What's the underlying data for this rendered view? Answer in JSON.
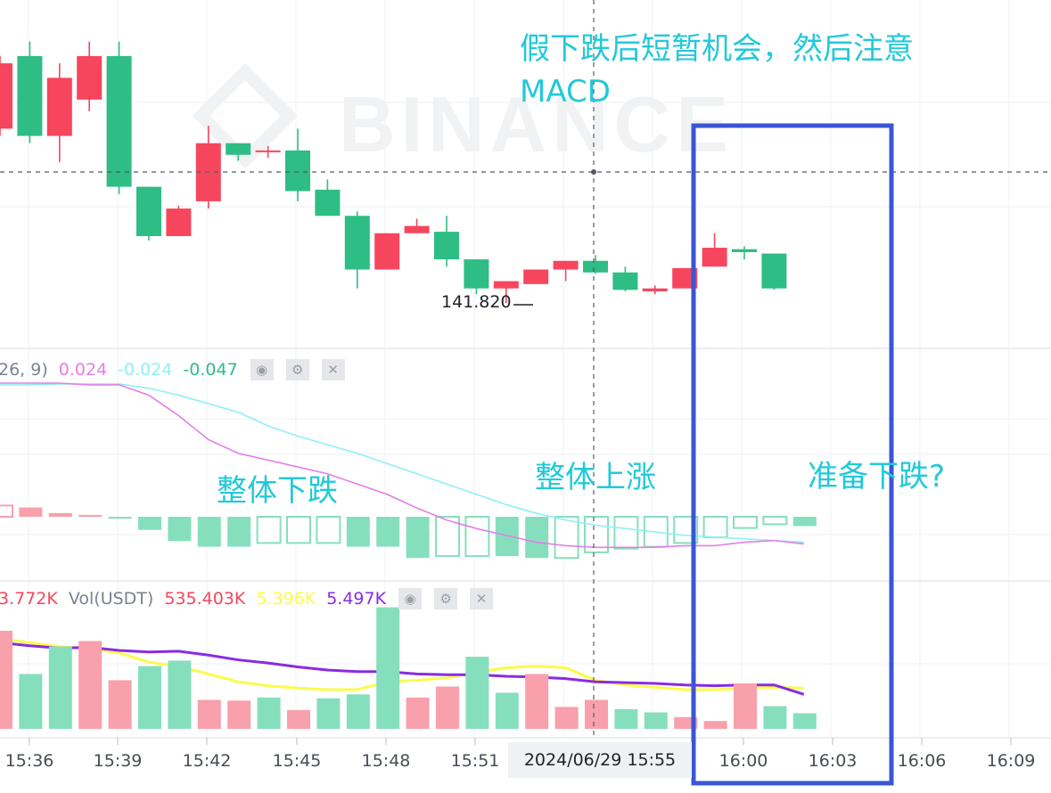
{
  "colors": {
    "up": "#f6465d",
    "down": "#2ebd85",
    "annotation": "#22c9d8",
    "highlight_box": "#3a56d4",
    "dif_line": "#e57de8",
    "dea_line": "#8ef0f7",
    "ma_yellow": "#fbfb4a",
    "ma_purple": "#8a2be2",
    "crosshair": "#555a66",
    "grid": "#eef0f3"
  },
  "watermark": "BINANCE",
  "price_label": "141.820",
  "crosshair_time": "2024/06/29 15:55",
  "macd_legend": {
    "params": "26, 9)",
    "dif": "0.024",
    "dea": "-0.024",
    "hist": "-0.047",
    "icons": [
      "eye-icon",
      "gear-icon",
      "close-icon"
    ]
  },
  "volume_legend": {
    "first": "3.772K",
    "name": "Vol(USDT)",
    "vol": "535.403K",
    "ma_yellow": "5.396K",
    "ma_purple": "5.497K",
    "icons": [
      "eye-icon",
      "gear-icon",
      "close-icon"
    ]
  },
  "annotations": {
    "top_line1": "假下跌后短暂机会，然后注意",
    "top_line2": "MACD",
    "overall_down": "整体下跌",
    "overall_up": "整体上涨",
    "prepare_down": "准备下跌?"
  },
  "chart_data": [
    {
      "type": "candlestick",
      "title": "",
      "x_tick_labels": [
        "15:36",
        "15:39",
        "15:42",
        "15:45",
        "15:48",
        "15:51",
        "16:00",
        "16:03",
        "16:06",
        "16:09"
      ],
      "annotated_low": 141.82,
      "candles": [
        {
          "time": "15:35",
          "open": 141.94,
          "close": 141.985,
          "high": 141.99,
          "low": 141.935,
          "dir": "up"
        },
        {
          "time": "15:36",
          "open": 141.99,
          "close": 141.935,
          "high": 142.0,
          "low": 141.93,
          "dir": "down"
        },
        {
          "time": "15:37",
          "open": 141.935,
          "close": 141.975,
          "high": 141.985,
          "low": 141.917,
          "dir": "up"
        },
        {
          "time": "15:38",
          "open": 141.96,
          "close": 141.99,
          "high": 142.0,
          "low": 141.952,
          "dir": "up"
        },
        {
          "time": "15:39",
          "open": 141.99,
          "close": 141.9,
          "high": 142.0,
          "low": 141.895,
          "dir": "down"
        },
        {
          "time": "15:40",
          "open": 141.9,
          "close": 141.866,
          "high": 141.9,
          "low": 141.863,
          "dir": "down"
        },
        {
          "time": "15:41",
          "open": 141.866,
          "close": 141.885,
          "high": 141.887,
          "low": 141.868,
          "dir": "up"
        },
        {
          "time": "15:42",
          "open": 141.89,
          "close": 141.93,
          "high": 141.942,
          "low": 141.885,
          "dir": "up"
        },
        {
          "time": "15:43",
          "open": 141.93,
          "close": 141.922,
          "high": 141.93,
          "low": 141.918,
          "dir": "down"
        },
        {
          "time": "15:44",
          "open": 141.925,
          "close": 141.925,
          "high": 141.928,
          "low": 141.92,
          "dir": "up"
        },
        {
          "time": "15:45",
          "open": 141.925,
          "close": 141.897,
          "high": 141.94,
          "low": 141.89,
          "dir": "down"
        },
        {
          "time": "15:46",
          "open": 141.898,
          "close": 141.88,
          "high": 141.905,
          "low": 141.88,
          "dir": "down"
        },
        {
          "time": "15:47",
          "open": 141.88,
          "close": 141.843,
          "high": 141.883,
          "low": 141.83,
          "dir": "down"
        },
        {
          "time": "15:48",
          "open": 141.843,
          "close": 141.868,
          "high": 141.868,
          "low": 141.843,
          "dir": "up"
        },
        {
          "time": "15:49",
          "open": 141.868,
          "close": 141.873,
          "high": 141.878,
          "low": 141.868,
          "dir": "up"
        },
        {
          "time": "15:50",
          "open": 141.869,
          "close": 141.85,
          "high": 141.88,
          "low": 141.845,
          "dir": "down"
        },
        {
          "time": "15:51",
          "open": 141.85,
          "close": 141.83,
          "high": 141.85,
          "low": 141.826,
          "dir": "down"
        },
        {
          "time": "15:52",
          "open": 141.83,
          "close": 141.835,
          "high": 141.835,
          "low": 141.82,
          "dir": "up"
        },
        {
          "time": "15:53",
          "open": 141.833,
          "close": 141.843,
          "high": 141.843,
          "low": 141.833,
          "dir": "up"
        },
        {
          "time": "15:54",
          "open": 141.843,
          "close": 141.849,
          "high": 141.849,
          "low": 141.835,
          "dir": "up"
        },
        {
          "time": "15:55",
          "open": 141.849,
          "close": 141.841,
          "high": 141.853,
          "low": 141.84,
          "dir": "down"
        },
        {
          "time": "15:56",
          "open": 141.841,
          "close": 141.829,
          "high": 141.845,
          "low": 141.828,
          "dir": "down"
        },
        {
          "time": "15:57",
          "open": 141.828,
          "close": 141.83,
          "high": 141.832,
          "low": 141.826,
          "dir": "up"
        },
        {
          "time": "15:58",
          "open": 141.83,
          "close": 141.844,
          "high": 141.844,
          "low": 141.83,
          "dir": "up"
        },
        {
          "time": "15:59",
          "open": 141.845,
          "close": 141.858,
          "high": 141.868,
          "low": 141.845,
          "dir": "up"
        },
        {
          "time": "16:00",
          "open": 141.857,
          "close": 141.855,
          "high": 141.859,
          "low": 141.85,
          "dir": "down"
        },
        {
          "time": "16:01",
          "open": 141.854,
          "close": 141.83,
          "high": 141.854,
          "low": 141.829,
          "dir": "down"
        }
      ]
    },
    {
      "type": "bar",
      "title": "MACD",
      "histogram": [
        {
          "value": 0.006,
          "dir": "up",
          "hollow": true
        },
        {
          "value": 0.005,
          "dir": "up",
          "hollow": false
        },
        {
          "value": 0.002,
          "dir": "up",
          "hollow": false
        },
        {
          "value": 0.001,
          "dir": "up",
          "hollow": false
        },
        {
          "value": -0.001,
          "dir": "down",
          "hollow": false
        },
        {
          "value": -0.007,
          "dir": "down",
          "hollow": false
        },
        {
          "value": -0.013,
          "dir": "down",
          "hollow": false
        },
        {
          "value": -0.016,
          "dir": "down",
          "hollow": false
        },
        {
          "value": -0.016,
          "dir": "down",
          "hollow": false
        },
        {
          "value": -0.014,
          "dir": "down",
          "hollow": true
        },
        {
          "value": -0.014,
          "dir": "down",
          "hollow": true
        },
        {
          "value": -0.014,
          "dir": "down",
          "hollow": true
        },
        {
          "value": -0.016,
          "dir": "down",
          "hollow": false
        },
        {
          "value": -0.016,
          "dir": "down",
          "hollow": false
        },
        {
          "value": -0.022,
          "dir": "down",
          "hollow": false
        },
        {
          "value": -0.021,
          "dir": "down",
          "hollow": true
        },
        {
          "value": -0.021,
          "dir": "down",
          "hollow": true
        },
        {
          "value": -0.021,
          "dir": "down",
          "hollow": false
        },
        {
          "value": -0.022,
          "dir": "down",
          "hollow": false
        },
        {
          "value": -0.022,
          "dir": "down",
          "hollow": true
        },
        {
          "value": -0.019,
          "dir": "down",
          "hollow": true
        },
        {
          "value": -0.017,
          "dir": "down",
          "hollow": true
        },
        {
          "value": -0.016,
          "dir": "down",
          "hollow": true
        },
        {
          "value": -0.014,
          "dir": "down",
          "hollow": true
        },
        {
          "value": -0.011,
          "dir": "down",
          "hollow": true
        },
        {
          "value": -0.006,
          "dir": "down",
          "hollow": true
        },
        {
          "value": -0.004,
          "dir": "down",
          "hollow": true
        },
        {
          "value": -0.005,
          "dir": "down",
          "hollow": false
        }
      ],
      "dif": [
        -0.006,
        -0.006,
        -0.0055,
        -0.0055,
        -0.0055,
        -0.008,
        -0.012,
        -0.017,
        -0.022,
        -0.03,
        -0.036,
        -0.041,
        -0.046,
        -0.052,
        -0.058,
        -0.064,
        -0.07,
        -0.076,
        -0.081,
        -0.085,
        -0.088,
        -0.09,
        -0.092,
        -0.094,
        -0.095,
        -0.096,
        -0.097,
        -0.098
      ],
      "dea": [
        -0.005,
        -0.005,
        -0.005,
        -0.006,
        -0.006,
        -0.012,
        -0.024,
        -0.038,
        -0.046,
        -0.05,
        -0.054,
        -0.058,
        -0.064,
        -0.07,
        -0.078,
        -0.085,
        -0.09,
        -0.094,
        -0.098,
        -0.1,
        -0.101,
        -0.101,
        -0.101,
        -0.1,
        -0.1,
        -0.098,
        -0.097,
        -0.099
      ]
    },
    {
      "type": "bar",
      "title": "Vol(USDT)",
      "volumes": [
        {
          "value": 12.5,
          "dir": "up"
        },
        {
          "value": 7.0,
          "dir": "down"
        },
        {
          "value": 10.5,
          "dir": "down"
        },
        {
          "value": 11.2,
          "dir": "up"
        },
        {
          "value": 6.2,
          "dir": "up"
        },
        {
          "value": 8.0,
          "dir": "down"
        },
        {
          "value": 8.7,
          "dir": "down"
        },
        {
          "value": 3.7,
          "dir": "up"
        },
        {
          "value": 3.6,
          "dir": "up"
        },
        {
          "value": 4.0,
          "dir": "down"
        },
        {
          "value": 2.4,
          "dir": "up"
        },
        {
          "value": 3.9,
          "dir": "down"
        },
        {
          "value": 4.4,
          "dir": "down"
        },
        {
          "value": 15.5,
          "dir": "down"
        },
        {
          "value": 4.0,
          "dir": "up"
        },
        {
          "value": 5.4,
          "dir": "up"
        },
        {
          "value": 9.2,
          "dir": "down"
        },
        {
          "value": 4.6,
          "dir": "down"
        },
        {
          "value": 7.0,
          "dir": "up"
        },
        {
          "value": 2.8,
          "dir": "up"
        },
        {
          "value": 3.7,
          "dir": "up"
        },
        {
          "value": 2.5,
          "dir": "down"
        },
        {
          "value": 2.1,
          "dir": "down"
        },
        {
          "value": 1.5,
          "dir": "up"
        },
        {
          "value": 1.0,
          "dir": "up"
        },
        {
          "value": 5.8,
          "dir": "up"
        },
        {
          "value": 2.9,
          "dir": "down"
        },
        {
          "value": 2.0,
          "dir": "down"
        }
      ],
      "ma_yellow": [
        11.5,
        11.0,
        10.5,
        10.2,
        9.7,
        8.5,
        8.0,
        7.0,
        6.0,
        5.5,
        5.2,
        5.0,
        5.0,
        6.0,
        6.2,
        6.5,
        7.2,
        7.8,
        8.0,
        7.8,
        6.2,
        5.6,
        5.3,
        5.0,
        5.0,
        5.2,
        5.3,
        5.2
      ],
      "ma_purple": [
        11.0,
        10.6,
        10.3,
        10.4,
        10.0,
        9.8,
        9.9,
        9.4,
        8.8,
        8.4,
        7.9,
        7.5,
        7.3,
        7.3,
        7.0,
        6.9,
        6.9,
        6.7,
        6.6,
        6.4,
        6.0,
        5.9,
        5.8,
        5.6,
        5.5,
        5.6,
        5.6,
        4.4
      ]
    }
  ]
}
